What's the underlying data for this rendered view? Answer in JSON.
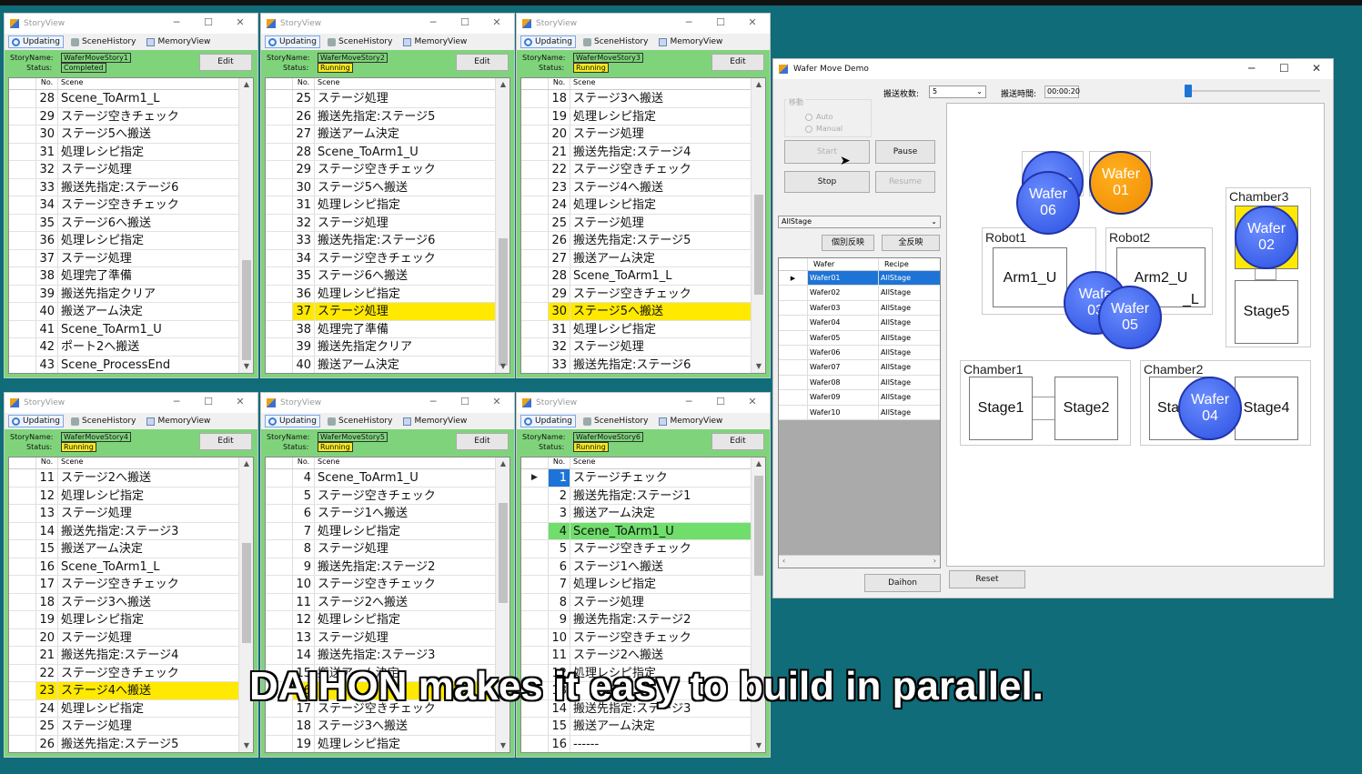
{
  "story_views": [
    {
      "title": "StoryView",
      "tabs": [
        "Updating",
        "SceneHistory",
        "MemoryView"
      ],
      "story_name_label": "StoryName:",
      "status_label": "Status:",
      "story_name": "WaferMoveStory1",
      "status": "Completed",
      "edit_label": "Edit",
      "col_no": "No.",
      "col_scene": "Scene",
      "rows": [
        {
          "no": "28",
          "scene": "Scene_ToArm1_L"
        },
        {
          "no": "29",
          "scene": "ステージ空きチェック"
        },
        {
          "no": "30",
          "scene": "ステージ5へ搬送"
        },
        {
          "no": "31",
          "scene": "処理レシピ指定"
        },
        {
          "no": "32",
          "scene": "ステージ処理"
        },
        {
          "no": "33",
          "scene": "搬送先指定:ステージ6"
        },
        {
          "no": "34",
          "scene": "ステージ空きチェック"
        },
        {
          "no": "35",
          "scene": "ステージ6へ搬送"
        },
        {
          "no": "36",
          "scene": "処理レシピ指定"
        },
        {
          "no": "37",
          "scene": "ステージ処理"
        },
        {
          "no": "38",
          "scene": "処理完了準備"
        },
        {
          "no": "39",
          "scene": "搬送先指定クリア"
        },
        {
          "no": "40",
          "scene": "搬送アーム決定"
        },
        {
          "no": "41",
          "scene": "Scene_ToArm1_U"
        },
        {
          "no": "42",
          "scene": "ポート2へ搬送"
        },
        {
          "no": "43",
          "scene": "Scene_ProcessEnd"
        }
      ]
    },
    {
      "title": "StoryView",
      "tabs": [
        "Updating",
        "SceneHistory",
        "MemoryView"
      ],
      "story_name_label": "StoryName:",
      "status_label": "Status:",
      "story_name": "WaferMoveStory2",
      "status": "Running",
      "edit_label": "Edit",
      "col_no": "No.",
      "col_scene": "Scene",
      "rows": [
        {
          "no": "25",
          "scene": "ステージ処理"
        },
        {
          "no": "26",
          "scene": "搬送先指定:ステージ5"
        },
        {
          "no": "27",
          "scene": "搬送アーム決定"
        },
        {
          "no": "28",
          "scene": "Scene_ToArm1_U"
        },
        {
          "no": "29",
          "scene": "ステージ空きチェック"
        },
        {
          "no": "30",
          "scene": "ステージ5へ搬送"
        },
        {
          "no": "31",
          "scene": "処理レシピ指定"
        },
        {
          "no": "32",
          "scene": "ステージ処理"
        },
        {
          "no": "33",
          "scene": "搬送先指定:ステージ6"
        },
        {
          "no": "34",
          "scene": "ステージ空きチェック"
        },
        {
          "no": "35",
          "scene": "ステージ6へ搬送"
        },
        {
          "no": "36",
          "scene": "処理レシピ指定"
        },
        {
          "no": "37",
          "scene": "ステージ処理",
          "highlight": "yellow"
        },
        {
          "no": "38",
          "scene": "処理完了準備"
        },
        {
          "no": "39",
          "scene": "搬送先指定クリア"
        },
        {
          "no": "40",
          "scene": "搬送アーム決定"
        }
      ]
    },
    {
      "title": "StoryView",
      "tabs": [
        "Updating",
        "SceneHistory",
        "MemoryView"
      ],
      "story_name_label": "StoryName:",
      "status_label": "Status:",
      "story_name": "WaferMoveStory3",
      "status": "Running",
      "edit_label": "Edit",
      "col_no": "No.",
      "col_scene": "Scene",
      "rows": [
        {
          "no": "18",
          "scene": "ステージ3へ搬送"
        },
        {
          "no": "19",
          "scene": "処理レシピ指定"
        },
        {
          "no": "20",
          "scene": "ステージ処理"
        },
        {
          "no": "21",
          "scene": "搬送先指定:ステージ4"
        },
        {
          "no": "22",
          "scene": "ステージ空きチェック"
        },
        {
          "no": "23",
          "scene": "ステージ4へ搬送"
        },
        {
          "no": "24",
          "scene": "処理レシピ指定"
        },
        {
          "no": "25",
          "scene": "ステージ処理"
        },
        {
          "no": "26",
          "scene": "搬送先指定:ステージ5"
        },
        {
          "no": "27",
          "scene": "搬送アーム決定"
        },
        {
          "no": "28",
          "scene": "Scene_ToArm1_L"
        },
        {
          "no": "29",
          "scene": "ステージ空きチェック"
        },
        {
          "no": "30",
          "scene": "ステージ5へ搬送",
          "highlight": "yellow"
        },
        {
          "no": "31",
          "scene": "処理レシピ指定"
        },
        {
          "no": "32",
          "scene": "ステージ処理"
        },
        {
          "no": "33",
          "scene": "搬送先指定:ステージ6"
        }
      ]
    },
    {
      "title": "StoryView",
      "tabs": [
        "Updating",
        "SceneHistory",
        "MemoryView"
      ],
      "story_name_label": "StoryName:",
      "status_label": "Status:",
      "story_name": "WaferMoveStory4",
      "status": "Running",
      "edit_label": "Edit",
      "col_no": "No.",
      "col_scene": "Scene",
      "rows": [
        {
          "no": "11",
          "scene": "ステージ2へ搬送"
        },
        {
          "no": "12",
          "scene": "処理レシピ指定"
        },
        {
          "no": "13",
          "scene": "ステージ処理"
        },
        {
          "no": "14",
          "scene": "搬送先指定:ステージ3"
        },
        {
          "no": "15",
          "scene": "搬送アーム決定"
        },
        {
          "no": "16",
          "scene": "Scene_ToArm1_L"
        },
        {
          "no": "17",
          "scene": "ステージ空きチェック"
        },
        {
          "no": "18",
          "scene": "ステージ3へ搬送"
        },
        {
          "no": "19",
          "scene": "処理レシピ指定"
        },
        {
          "no": "20",
          "scene": "ステージ処理"
        },
        {
          "no": "21",
          "scene": "搬送先指定:ステージ4"
        },
        {
          "no": "22",
          "scene": "ステージ空きチェック"
        },
        {
          "no": "23",
          "scene": "ステージ4へ搬送",
          "highlight": "yellow"
        },
        {
          "no": "24",
          "scene": "処理レシピ指定"
        },
        {
          "no": "25",
          "scene": "ステージ処理"
        },
        {
          "no": "26",
          "scene": "搬送先指定:ステージ5"
        }
      ]
    },
    {
      "title": "StoryView",
      "tabs": [
        "Updating",
        "SceneHistory",
        "MemoryView"
      ],
      "story_name_label": "StoryName:",
      "status_label": "Status:",
      "story_name": "WaferMoveStory5",
      "status": "Running",
      "edit_label": "Edit",
      "col_no": "No.",
      "col_scene": "Scene",
      "rows": [
        {
          "no": "4",
          "scene": "Scene_ToArm1_U"
        },
        {
          "no": "5",
          "scene": "ステージ空きチェック"
        },
        {
          "no": "6",
          "scene": "ステージ1へ搬送"
        },
        {
          "no": "7",
          "scene": "処理レシピ指定"
        },
        {
          "no": "8",
          "scene": "ステージ処理"
        },
        {
          "no": "9",
          "scene": "搬送先指定:ステージ2"
        },
        {
          "no": "10",
          "scene": "ステージ空きチェック"
        },
        {
          "no": "11",
          "scene": "ステージ2へ搬送"
        },
        {
          "no": "12",
          "scene": "処理レシピ指定"
        },
        {
          "no": "13",
          "scene": "ステージ処理"
        },
        {
          "no": "14",
          "scene": "搬送先指定:ステージ3"
        },
        {
          "no": "15",
          "scene": "搬送アーム決定"
        },
        {
          "no": "16",
          "scene": "",
          "highlight": "yellow"
        },
        {
          "no": "17",
          "scene": "ステージ空きチェック"
        },
        {
          "no": "18",
          "scene": "ステージ3へ搬送"
        },
        {
          "no": "19",
          "scene": "処理レシピ指定"
        }
      ]
    },
    {
      "title": "StoryView",
      "tabs": [
        "Updating",
        "SceneHistory",
        "MemoryView"
      ],
      "story_name_label": "StoryName:",
      "status_label": "Status:",
      "story_name": "WaferMoveStory6",
      "status": "Running",
      "edit_label": "Edit",
      "col_no": "No.",
      "col_scene": "Scene",
      "rows": [
        {
          "no": "1",
          "scene": "ステージチェック",
          "selnum": true,
          "current": true
        },
        {
          "no": "2",
          "scene": "搬送先指定:ステージ1"
        },
        {
          "no": "3",
          "scene": "搬送アーム決定"
        },
        {
          "no": "4",
          "scene": "Scene_ToArm1_U",
          "highlight": "green"
        },
        {
          "no": "5",
          "scene": "ステージ空きチェック"
        },
        {
          "no": "6",
          "scene": "ステージ1へ搬送"
        },
        {
          "no": "7",
          "scene": "処理レシピ指定"
        },
        {
          "no": "8",
          "scene": "ステージ処理"
        },
        {
          "no": "9",
          "scene": "搬送先指定:ステージ2"
        },
        {
          "no": "10",
          "scene": "ステージ空きチェック"
        },
        {
          "no": "11",
          "scene": "ステージ2へ搬送"
        },
        {
          "no": "12",
          "scene": "処理レシピ指定"
        },
        {
          "no": "13",
          "scene": ""
        },
        {
          "no": "14",
          "scene": "搬送先指定:ステージ3"
        },
        {
          "no": "15",
          "scene": "搬送アーム決定"
        },
        {
          "no": "16",
          "scene": "------"
        }
      ]
    }
  ],
  "wafer_demo": {
    "title": "Wafer Move Demo",
    "transfer_count_label": "搬送枚数:",
    "transfer_count_value": "5",
    "transfer_time_label": "搬送時間:",
    "transfer_time_value": "00:00:20",
    "move_group_label": "移動",
    "radio_auto": "Auto",
    "radio_manual": "Manual",
    "start": "Start",
    "pause": "Pause",
    "stop": "Stop",
    "resume": "Resume",
    "stage_select": "AllStage",
    "btn_individual": "個別反映",
    "btn_all": "全反映",
    "table_headers": [
      "Wafer",
      "Recipe"
    ],
    "table_rows": [
      {
        "wafer": "Wafer01",
        "recipe": "AllStage"
      },
      {
        "wafer": "Wafer02",
        "recipe": "AllStage"
      },
      {
        "wafer": "Wafer03",
        "recipe": "AllStage"
      },
      {
        "wafer": "Wafer04",
        "recipe": "AllStage"
      },
      {
        "wafer": "Wafer05",
        "recipe": "AllStage"
      },
      {
        "wafer": "Wafer06",
        "recipe": "AllStage"
      },
      {
        "wafer": "Wafer07",
        "recipe": "AllStage"
      },
      {
        "wafer": "Wafer08",
        "recipe": "AllStage"
      },
      {
        "wafer": "Wafer09",
        "recipe": "AllStage"
      },
      {
        "wafer": "Wafer10",
        "recipe": "AllStage"
      }
    ],
    "daihon_button": "Daihon",
    "reset_button": "Reset",
    "robot1_label": "Robot1",
    "robot2_label": "Robot2",
    "arm1_label": "Arm1_U",
    "arm2_label": "Arm2_U",
    "arm2_lower_partial": "_L",
    "chamber1_label": "Chamber1",
    "chamber2_label": "Chamber2",
    "chamber3_label": "Chamber3",
    "stage1": "Stage1",
    "stage2": "Stage2",
    "stage3_partial": "Sta",
    "stage4": "Stage4",
    "stage5": "Stage5",
    "wafers": {
      "w01": [
        "Wafer",
        "01"
      ],
      "w02": [
        "Wafer",
        "02"
      ],
      "w03": [
        "Wafe",
        "03"
      ],
      "w04": [
        "Wafer",
        "04"
      ],
      "w05": [
        "Wafer",
        "05"
      ],
      "w06": [
        "Wafer",
        "06"
      ],
      "w07_partial": [
        "Wafer",
        ""
      ]
    }
  },
  "subtitle": "DAIHON makes it easy to build in parallel.",
  "colors": {
    "background": "#0f6c78",
    "panel_green": "#7fd47b",
    "highlight_yellow": "#ffe900",
    "highlight_green": "#6fde6b",
    "wafer_blue": "#2a4fe0",
    "wafer_orange": "#f08a00"
  }
}
